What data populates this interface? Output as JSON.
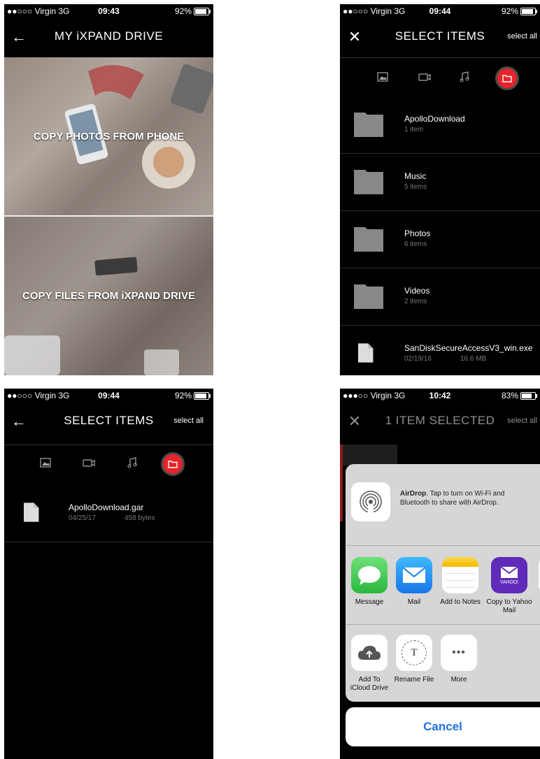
{
  "status": {
    "s1": {
      "carrier": "●●○○○ Virgin  3G",
      "time": "09:43",
      "battery": "92%",
      "battery_level": 0.92
    },
    "s2": {
      "carrier": "●●○○○ Virgin  3G",
      "time": "09:44",
      "battery": "92%",
      "battery_level": 0.92
    },
    "s3": {
      "carrier": "●●○○○ Virgin  3G",
      "time": "09:44",
      "battery": "92%",
      "battery_level": 0.92
    },
    "s4": {
      "carrier": "●●●○○ Virgin  3G",
      "time": "10:42",
      "battery": "83%",
      "battery_level": 0.83
    }
  },
  "screen1": {
    "title": "MY iXPAND DRIVE",
    "tile_top": "COPY PHOTOS FROM PHONE",
    "tile_bottom": "COPY FILES FROM iXPAND DRIVE"
  },
  "screen2": {
    "title": "SELECT ITEMS",
    "select_all": "select all",
    "items": [
      {
        "name": "ApolloDownload",
        "meta": "1 item"
      },
      {
        "name": "Music",
        "meta": "5 items"
      },
      {
        "name": "Photos",
        "meta": "6 items"
      },
      {
        "name": "Videos",
        "meta": "2 items"
      },
      {
        "name": "SanDiskSecureAccessV3_win.exe",
        "date": "02/19/16",
        "size": "16.6 MB"
      }
    ]
  },
  "screen3": {
    "title": "SELECT ITEMS",
    "select_all": "select all",
    "file": {
      "name": "ApolloDownload.gar",
      "date": "04/25/17",
      "size": "458 bytes"
    }
  },
  "screen4": {
    "title": "1 ITEM SELECTED",
    "select_all": "select all",
    "airdrop_bold": "AirDrop",
    "airdrop_text": ". Tap to turn on Wi-Fi and Bluetooth to share with AirDrop.",
    "apps": [
      {
        "label": "Message"
      },
      {
        "label": "Mail"
      },
      {
        "label": "Add to Notes"
      },
      {
        "label": "Copy to Yahoo Mail"
      }
    ],
    "yahoo_logo": "YAHOO!",
    "actions": [
      {
        "label": "Add To iCloud Drive"
      },
      {
        "label": "Rename File"
      },
      {
        "label": "More"
      }
    ],
    "rename_glyph": "T",
    "more_glyph": "•••",
    "cancel": "Cancel"
  },
  "colors": {
    "accent": "#e8232a",
    "cancel_blue": "#1a6fe0",
    "sheet_bg": "#d6d6d6"
  }
}
